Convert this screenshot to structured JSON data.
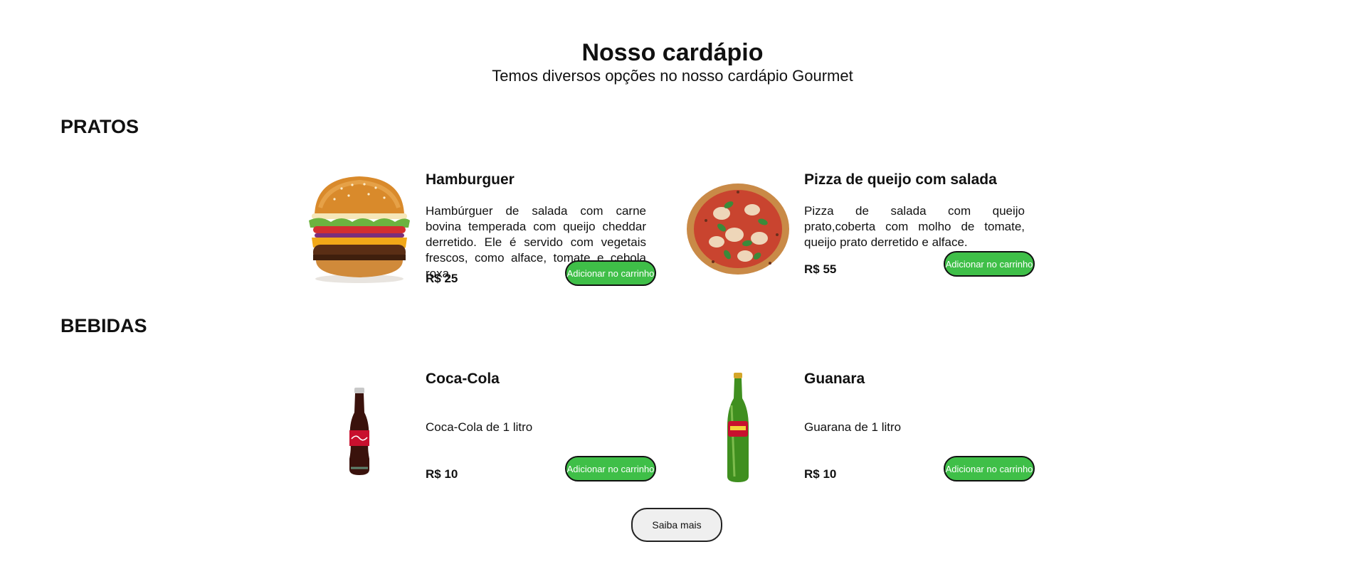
{
  "header": {
    "title": "Nosso cardápio",
    "subtitle": "Temos diversos opções no nosso cardápio Gourmet"
  },
  "sections": [
    {
      "title": "PRATOS",
      "items": [
        {
          "name": "Hamburguer",
          "description": "Hambúrguer de salada com carne bovina temperada com queijo cheddar derretido. Ele é servido com vegetais frescos, como alface, tomate e cebola roxa",
          "price": "R$ 25",
          "button": "Adicionar no carrinho",
          "icon": "burger-image"
        },
        {
          "name": "Pizza de queijo com salada",
          "description": "Pizza de salada com queijo prato,coberta com molho de tomate, queijo prato derretido e alface.",
          "price": "R$ 55",
          "button": "Adicionar no carrinho",
          "icon": "pizza-image"
        }
      ]
    },
    {
      "title": "BEBIDAS",
      "items": [
        {
          "name": "Coca-Cola",
          "description": "Coca-Cola de 1 litro",
          "price": "R$ 10",
          "button": "Adicionar no carrinho",
          "icon": "cola-bottle-image"
        },
        {
          "name": "Guanara",
          "description": "Guarana de 1 litro",
          "price": "R$ 10",
          "button": "Adicionar no carrinho",
          "icon": "guarana-bottle-image"
        }
      ]
    }
  ],
  "more_button": "Saiba mais",
  "colors": {
    "accent": "#3fbf48",
    "background": "#ffffff",
    "text": "#111111"
  }
}
